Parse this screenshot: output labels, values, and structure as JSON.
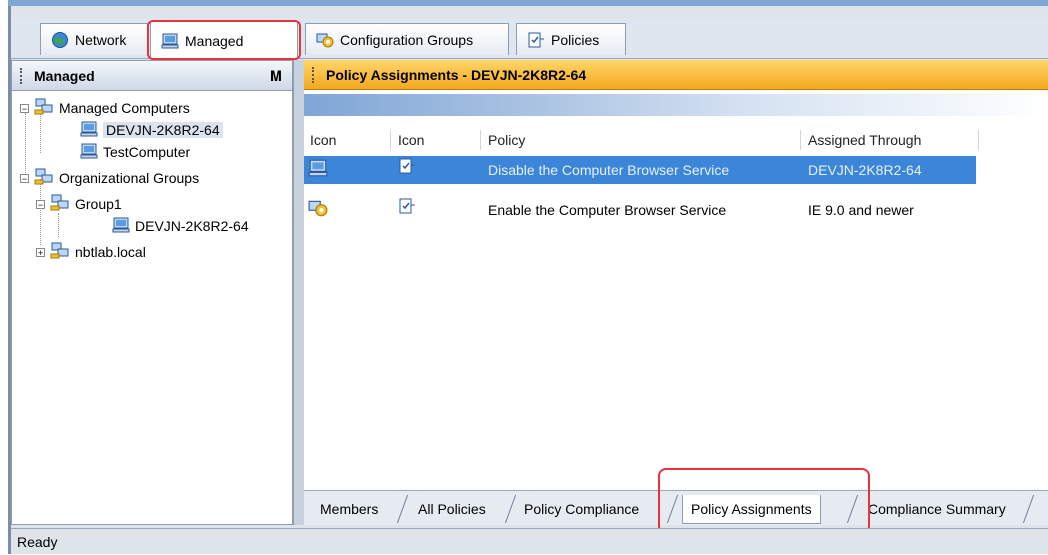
{
  "top_tabs": [
    {
      "label": "Network",
      "icon": "globe-icon"
    },
    {
      "label": "Managed",
      "icon": "computer-icon"
    },
    {
      "label": "Configuration Groups",
      "icon": "config-groups-icon"
    },
    {
      "label": "Policies",
      "icon": "policy-icon"
    }
  ],
  "left_panel": {
    "title": "Managed",
    "pin": "p",
    "tree": [
      {
        "label": "Managed Computers",
        "icon": "group-computers-icon",
        "expander": "−"
      },
      {
        "label": "DEVJN-2K8R2-64",
        "icon": "computer-icon",
        "selected": true
      },
      {
        "label": "TestComputer",
        "icon": "computer-icon"
      },
      {
        "label": "Organizational Groups",
        "icon": "group-computers-icon",
        "expander": "−"
      },
      {
        "label": "Group1",
        "icon": "group-computers-icon",
        "expander": "−"
      },
      {
        "label": "DEVJN-2K8R2-64",
        "icon": "computer-icon"
      },
      {
        "label": "nbtlab.local",
        "icon": "group-computers-icon",
        "expander": "+"
      }
    ]
  },
  "right_panel": {
    "title": "Policy Assignments - DEVJN-2K8R2-64",
    "columns": [
      "Icon",
      "Icon",
      "Policy",
      "Assigned Through"
    ],
    "rows": [
      {
        "icon1": "computer-icon",
        "icon2": "policy-icon",
        "policy": "Disable the Computer Browser Service",
        "assigned_through": "DEVJN-2K8R2-64",
        "selected": true
      },
      {
        "icon1": "config-groups-icon",
        "icon2": "policy-icon",
        "policy": "Enable the Computer Browser Service",
        "assigned_through": "IE 9.0 and newer",
        "selected": false
      }
    ]
  },
  "bottom_tabs": [
    "Members",
    "All Policies",
    "Policy Compliance",
    "Policy Assignments",
    "Compliance Summary"
  ],
  "active_bottom_tab": "Policy Assignments",
  "status": "Ready",
  "colors": {
    "selection": "#3b86d9",
    "header_orange": "#f3a81e",
    "highlight_red": "#e8333d"
  }
}
